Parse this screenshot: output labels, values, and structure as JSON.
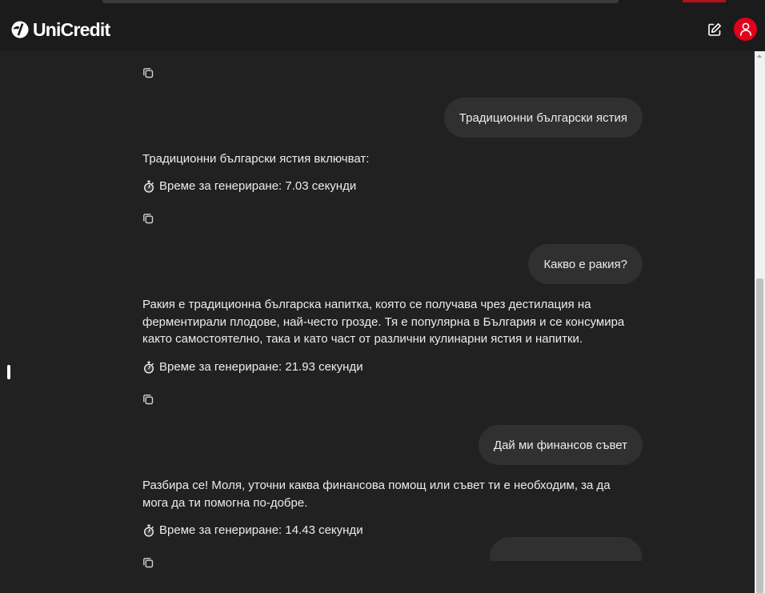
{
  "app": {
    "brand": "UniCredit",
    "icons": {
      "logo": "unicredit-logo-icon",
      "new_chat": "edit-icon",
      "user": "user-icon",
      "copy": "copy-icon",
      "stopwatch": "stopwatch-icon"
    },
    "colors": {
      "accent": "#e2001a",
      "background": "#212121",
      "header": "#1b1b1b",
      "bubble": "#303030",
      "text": "#ececec"
    }
  },
  "messages": [
    {
      "role": "user",
      "text": "Традиционни български ястия"
    },
    {
      "role": "assistant",
      "text": "Традиционни български ястия включват:",
      "timing": "Време за генериране: 7.03 секунди"
    },
    {
      "role": "user",
      "text": "Какво е ракия?"
    },
    {
      "role": "assistant",
      "text": "Ракия е традиционна българска напитка, която се получава чрез дестилация на ферментирали плодове, най-често грозде. Тя е популярна в България и се консумира както самостоятелно, така и като част от различни кулинарни ястия и напитки.",
      "timing": "Време за генериране: 21.93 секунди"
    },
    {
      "role": "user",
      "text": "Дай ми финансов съвет"
    },
    {
      "role": "assistant",
      "text": "Разбира се! Моля, уточни каква финансова помощ или съвет ти е необходим, за да мога да ти помогна по-добре.",
      "timing": "Време за генериране: 14.43 секунди"
    }
  ]
}
